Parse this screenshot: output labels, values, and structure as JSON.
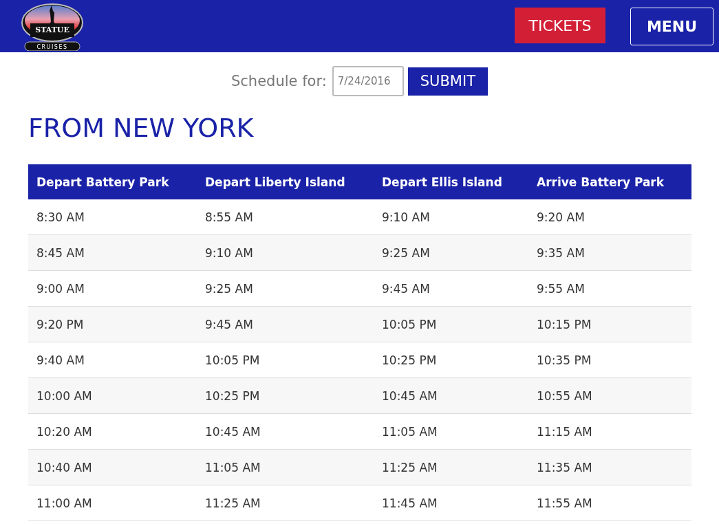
{
  "header": {
    "logo": {
      "title": "STATUE",
      "subtitle": "CRUISES"
    },
    "buttons": [
      {
        "kind": "tickets",
        "label": "TICKETS"
      },
      {
        "kind": "menu",
        "label": "MENU"
      }
    ]
  },
  "schedule_form": {
    "label": "Schedule for:",
    "date": "7/24/2016",
    "submit": "SUBMIT"
  },
  "section_title": "FROM NEW YORK",
  "table": {
    "columns": [
      "Depart Battery Park",
      "Depart Liberty Island",
      "Depart Ellis Island",
      "Arrive Battery Park"
    ],
    "rows": [
      [
        "8:30 AM",
        "8:55 AM",
        "9:10 AM",
        "9:20 AM"
      ],
      [
        "8:45 AM",
        "9:10 AM",
        "9:25 AM",
        "9:35 AM"
      ],
      [
        "9:00 AM",
        "9:25 AM",
        "9:45 AM",
        "9:55 AM"
      ],
      [
        "9:20 PM",
        "9:45 AM",
        "10:05 PM",
        "10:15 PM"
      ],
      [
        "9:40 AM",
        "10:05 PM",
        "10:25 PM",
        "10:35 PM"
      ],
      [
        "10:00 AM",
        "10:25 PM",
        "10:45 AM",
        "10:55 AM"
      ],
      [
        "10:20 AM",
        "10:45 AM",
        "11:05 AM",
        "11:15 AM"
      ],
      [
        "10:40 AM",
        "11:05 AM",
        "11:25 AM",
        "11:35 AM"
      ],
      [
        "11:00 AM",
        "11:25 AM",
        "11:45 AM",
        "11:55 AM"
      ]
    ]
  }
}
